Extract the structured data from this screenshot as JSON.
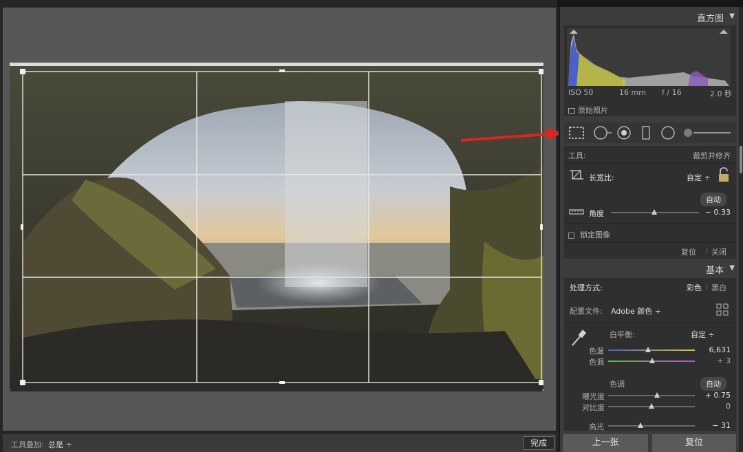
{
  "panels": {
    "histogram": {
      "title": "直方图",
      "exif": {
        "iso": "ISO 50",
        "focal": "16 mm",
        "aperture": "f / 16",
        "shutter": "2.0 秒"
      },
      "original_photo_label": "原始照片"
    },
    "crop": {
      "tools_label": "工具:",
      "tool_name": "裁剪并修齐",
      "aspect_label": "长宽比:",
      "aspect_value": "自定 ÷",
      "auto_label": "自动",
      "angle_label": "角度",
      "angle_value": "− 0.33",
      "constrain_label": "锁定图像",
      "reset_label": "复位",
      "close_label": "关闭"
    },
    "basic": {
      "title": "基本",
      "treatment_label": "处理方式:",
      "treatment_color": "彩色",
      "treatment_bw": "黑白",
      "profile_label": "配置文件:",
      "profile_value": "Adobe 颜色 ÷",
      "wb_label": "白平衡:",
      "wb_value": "自定 ÷",
      "temp_label": "色温",
      "temp_value": "6,631",
      "tint_label": "色调",
      "tint_value": "+ 3",
      "tone_label": "色调",
      "tone_auto": "自动",
      "exposure_label": "曝光度",
      "exposure_value": "+ 0.75",
      "contrast_label": "对比度",
      "contrast_value": "0",
      "highlights_label": "高光",
      "highlights_value": "− 31"
    },
    "buttons": {
      "prev": "上一张",
      "reset": "复位"
    }
  },
  "toolbar": {
    "overlay_label": "工具叠加:",
    "overlay_value": "总是 ÷",
    "done_label": "完成"
  },
  "icons": [
    "crop-overlay-icon",
    "spot-removal-icon",
    "red-eye-icon",
    "graduated-filter-icon",
    "radial-filter-icon",
    "adjustment-brush-icon",
    "lock-icon",
    "eyedropper-icon",
    "grid-icon",
    "straighten-icon"
  ],
  "colors": {
    "accent_arrow": "#d8281e",
    "panel_bg": "#3c3c3c",
    "workspace_bg": "#575757"
  },
  "slider_levels": {
    "angle": 0.49,
    "temperature": 0.46,
    "tint": 0.51,
    "exposure": 0.56,
    "contrast": 0.5,
    "highlights": 0.37
  }
}
